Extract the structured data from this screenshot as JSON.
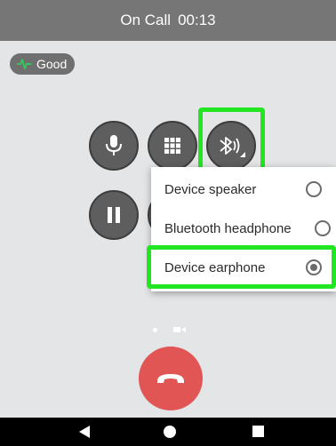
{
  "status_bar": {
    "title": "On Call",
    "timer": "00:13",
    "background": "#767676"
  },
  "call_quality": {
    "label": "Good",
    "icon": "signal-wave-icon",
    "accent": "#34c759"
  },
  "controls": [
    {
      "name": "mute-button",
      "icon": "microphone-icon"
    },
    {
      "name": "dialpad-button",
      "icon": "dialpad-grid-icon"
    },
    {
      "name": "audio-route-button",
      "icon": "bluetooth-audio-icon"
    },
    {
      "name": "hold-button",
      "icon": "pause-icon"
    }
  ],
  "audio_menu": {
    "items": [
      {
        "label": "Device speaker",
        "selected": false
      },
      {
        "label": "Bluetooth headphone",
        "selected": false
      },
      {
        "label": "Device earphone",
        "selected": true
      }
    ]
  },
  "end_call": {
    "icon": "hangup-phone-icon",
    "color": "#e25555"
  },
  "page_indicator": {
    "icons": [
      "page-dot",
      "video-camera-icon"
    ]
  },
  "navigation": {
    "icons": [
      "back-triangle-icon",
      "home-circle-icon",
      "recents-square-icon"
    ]
  },
  "highlight_color": "#22e622"
}
